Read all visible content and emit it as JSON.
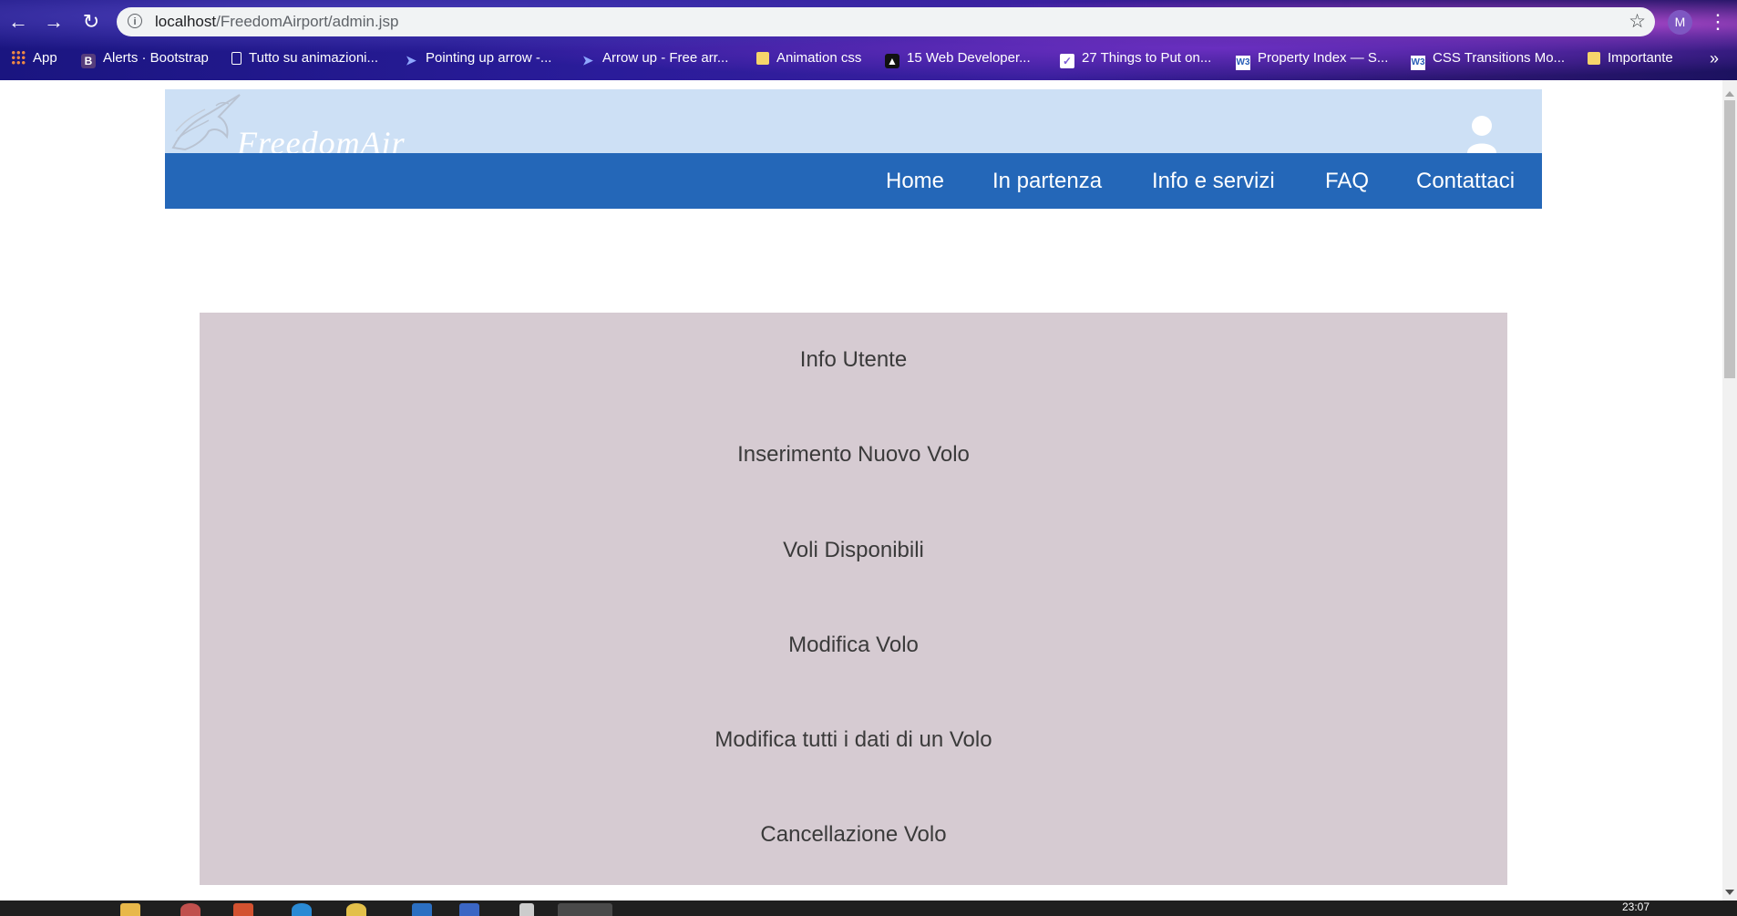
{
  "browser": {
    "url_host": "localhost",
    "url_path": "/FreedomAirport/admin.jsp",
    "profile_initial": "M",
    "bookmarks": [
      {
        "label": "App",
        "icon": "apps-grid-icon"
      },
      {
        "label": "Alerts · Bootstrap",
        "icon": "bootstrap-icon"
      },
      {
        "label": "Tutto su animazioni...",
        "icon": "document-icon"
      },
      {
        "label": "Pointing up arrow -...",
        "icon": "arrow-site-icon"
      },
      {
        "label": "Arrow up - Free arr...",
        "icon": "arrow-site-icon"
      },
      {
        "label": "Animation css",
        "icon": "folder-icon"
      },
      {
        "label": "15 Web Developer...",
        "icon": "dev-site-icon"
      },
      {
        "label": "27 Things to Put on...",
        "icon": "pen-site-icon"
      },
      {
        "label": "Property Index — S...",
        "icon": "w3-icon"
      },
      {
        "label": "CSS Transitions Mo...",
        "icon": "w3-icon"
      },
      {
        "label": "Importante",
        "icon": "folder-icon"
      }
    ],
    "more_bookmarks": "»"
  },
  "site": {
    "logo_text": "FreedomAir",
    "nav": [
      "Home",
      "In partenza",
      "Info e servizi",
      "FAQ",
      "Contattaci"
    ]
  },
  "admin_menu": [
    "Info Utente",
    "Inserimento Nuovo Volo",
    "Voli Disponibili",
    "Modifica Volo",
    "Modifica tutti i dati di un Volo",
    "Cancellazione Volo"
  ],
  "taskbar": {
    "clock": "23:07"
  },
  "colors": {
    "header_bg": "#cde0f5",
    "navbar_bg": "#2467b8",
    "panel_bg": "#d6cbd2"
  }
}
